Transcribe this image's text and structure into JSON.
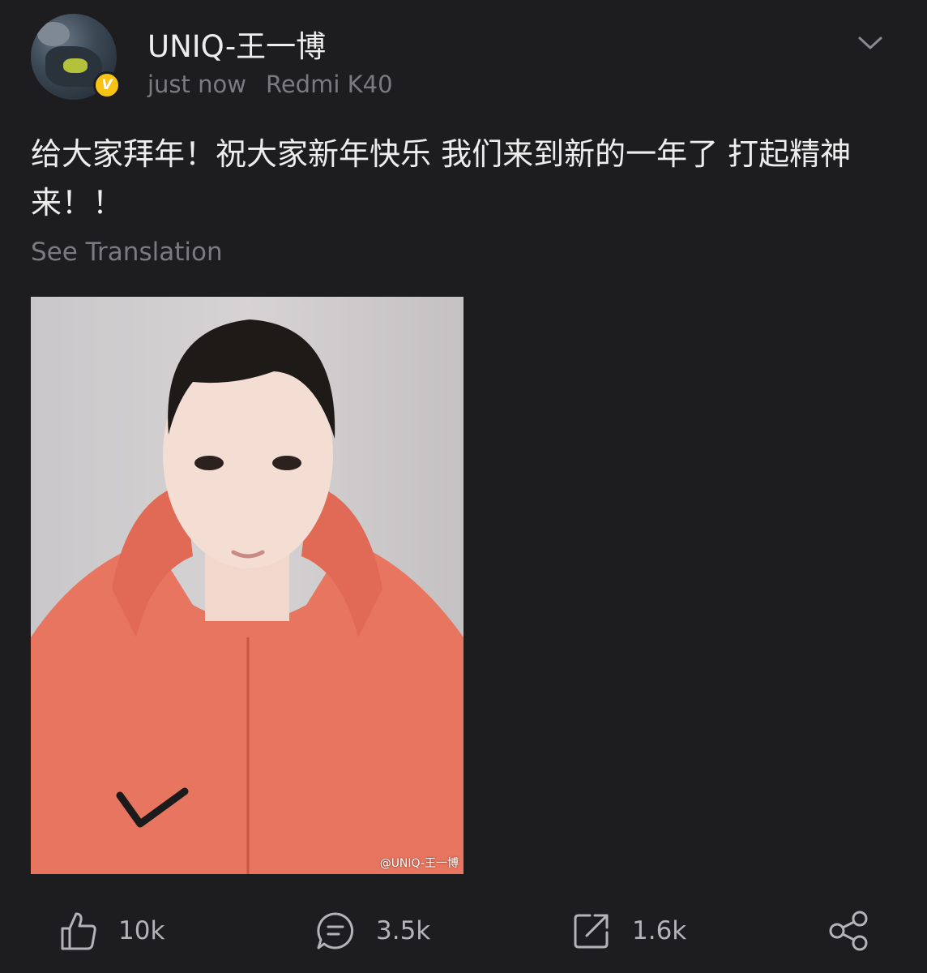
{
  "post": {
    "username": "UNIQ-王一博",
    "timestamp": "just now",
    "device": "Redmi K40",
    "verified_badge_letter": "V",
    "text": "给大家拜年！祝大家新年快乐 我们来到新的一年了 打起精神来！！",
    "see_translation": "See Translation",
    "image_watermark": "@UNIQ-王一博"
  },
  "actions": {
    "like": {
      "icon": "thumbs-up-icon",
      "count": "10k"
    },
    "comment": {
      "icon": "comment-icon",
      "count": "3.5k"
    },
    "repost": {
      "icon": "repost-icon",
      "count": "1.6k"
    },
    "share": {
      "icon": "share-icon"
    }
  },
  "colors": {
    "background": "#1d1d1f",
    "primary_text": "#ededed",
    "secondary_text": "#7b7b7f",
    "icon": "#b4b4b8",
    "verified_badge": "#f7c315"
  }
}
